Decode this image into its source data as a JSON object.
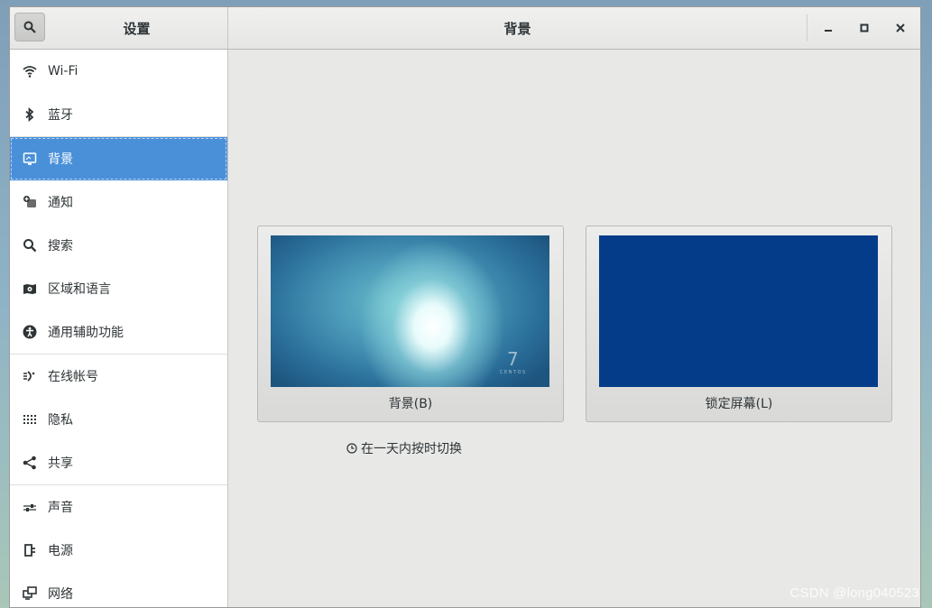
{
  "header": {
    "sidebar_title": "设置",
    "panel_title": "背景"
  },
  "sidebar": {
    "items": [
      {
        "label": "Wi-Fi",
        "icon": "wifi-icon"
      },
      {
        "label": "蓝牙",
        "icon": "bluetooth-icon"
      },
      {
        "label": "背景",
        "icon": "background-icon",
        "active": true
      },
      {
        "label": "通知",
        "icon": "notification-icon"
      },
      {
        "label": "搜索",
        "icon": "search-icon"
      },
      {
        "label": "区域和语言",
        "icon": "region-icon"
      },
      {
        "label": "通用辅助功能",
        "icon": "accessibility-icon"
      },
      {
        "label": "在线帐号",
        "icon": "online-accounts-icon"
      },
      {
        "label": "隐私",
        "icon": "privacy-icon"
      },
      {
        "label": "共享",
        "icon": "share-icon"
      },
      {
        "label": "声音",
        "icon": "sound-icon"
      },
      {
        "label": "电源",
        "icon": "power-icon"
      },
      {
        "label": "网络",
        "icon": "network-icon"
      }
    ]
  },
  "main": {
    "background_label": "背景(B)",
    "lock_label": "锁定屏幕(L)",
    "timed_label": "在一天内按时切换",
    "thumb_logo": "7",
    "thumb_logo_text": "CENTOS"
  },
  "colors": {
    "accent": "#4a90d9",
    "lock_screen": "#043c8a"
  },
  "watermark": "CSDN @long040523"
}
